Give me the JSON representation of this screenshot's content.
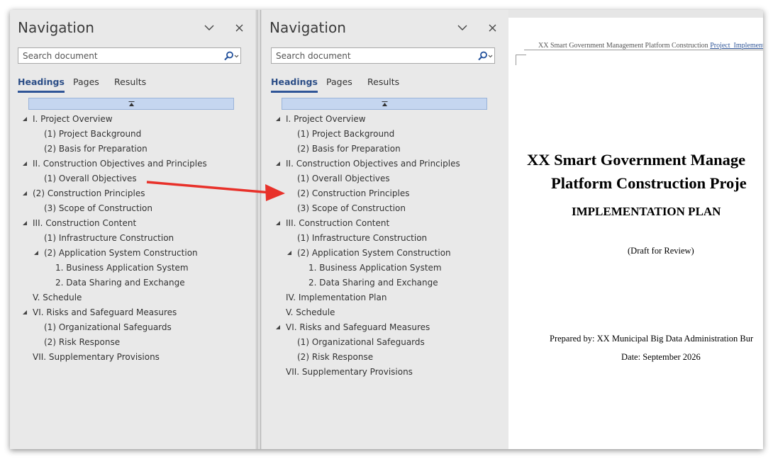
{
  "nav_panes": [
    {
      "title": "Navigation",
      "search_placeholder": "Search document",
      "tabs": [
        "Headings",
        "Pages",
        "Results"
      ],
      "active_tab": "Headings",
      "headings": [
        {
          "text": "I. Project Overview",
          "level": 0,
          "expander": true
        },
        {
          "text": "(1) Project Background",
          "level": 1,
          "expander": false
        },
        {
          "text": "(2) Basis for Preparation",
          "level": 1,
          "expander": false
        },
        {
          "text": "II. Construction Objectives and Principles",
          "level": 0,
          "expander": true
        },
        {
          "text": "(1) Overall Objectives",
          "level": 1,
          "expander": false
        },
        {
          "text": "(2) Construction Principles",
          "level": 0,
          "expander": true
        },
        {
          "text": "(3) Scope of Construction",
          "level": 1,
          "expander": false
        },
        {
          "text": "III. Construction Content",
          "level": 0,
          "expander": true
        },
        {
          "text": "(1) Infrastructure Construction",
          "level": 1,
          "expander": false
        },
        {
          "text": "(2) Application System Construction",
          "level": 1,
          "expander": true
        },
        {
          "text": "1. Business Application System",
          "level": 2,
          "expander": false
        },
        {
          "text": "2. Data Sharing and Exchange",
          "level": 2,
          "expander": false
        },
        {
          "text": "V. Schedule",
          "level": 0,
          "expander": false
        },
        {
          "text": "VI. Risks and Safeguard Measures",
          "level": 0,
          "expander": true
        },
        {
          "text": "(1) Organizational Safeguards",
          "level": 1,
          "expander": false
        },
        {
          "text": "(2) Risk Response",
          "level": 1,
          "expander": false
        },
        {
          "text": "VII. Supplementary Provisions",
          "level": 0,
          "expander": false
        }
      ]
    },
    {
      "title": "Navigation",
      "search_placeholder": "Search document",
      "tabs": [
        "Headings",
        "Pages",
        "Results"
      ],
      "active_tab": "Headings",
      "headings": [
        {
          "text": "I. Project Overview",
          "level": 0,
          "expander": true
        },
        {
          "text": "(1) Project Background",
          "level": 1,
          "expander": false
        },
        {
          "text": "(2) Basis for Preparation",
          "level": 1,
          "expander": false
        },
        {
          "text": "II. Construction Objectives and Principles",
          "level": 0,
          "expander": true
        },
        {
          "text": "(1) Overall Objectives",
          "level": 1,
          "expander": false
        },
        {
          "text": "(2) Construction Principles",
          "level": 1,
          "expander": false
        },
        {
          "text": "(3) Scope of Construction",
          "level": 1,
          "expander": false
        },
        {
          "text": "III. Construction Content",
          "level": 0,
          "expander": true
        },
        {
          "text": "(1) Infrastructure Construction",
          "level": 1,
          "expander": false
        },
        {
          "text": "(2) Application System Construction",
          "level": 1,
          "expander": true
        },
        {
          "text": "1. Business Application System",
          "level": 2,
          "expander": false
        },
        {
          "text": "2. Data Sharing and Exchange",
          "level": 2,
          "expander": false
        },
        {
          "text": "IV. Implementation Plan",
          "level": 0,
          "expander": false
        },
        {
          "text": "V. Schedule",
          "level": 0,
          "expander": false
        },
        {
          "text": "VI. Risks and Safeguard Measures",
          "level": 0,
          "expander": true
        },
        {
          "text": "(1) Organizational Safeguards",
          "level": 1,
          "expander": false
        },
        {
          "text": "(2) Risk Response",
          "level": 1,
          "expander": false
        },
        {
          "text": "VII. Supplementary Provisions",
          "level": 0,
          "expander": false
        }
      ]
    }
  ],
  "document": {
    "header_text": "XX Smart Government Management Platform Construction ",
    "header_link": "Project_Implementa",
    "title_line1": "XX Smart Government Manage",
    "title_line2": "Platform Construction Proje",
    "title_line3": "IMPLEMENTATION PLAN",
    "draft_note": "(Draft for Review)",
    "prepared_by": "Prepared by: XX Municipal Big Data Administration Bur",
    "date": "Date: September 2026"
  },
  "colors": {
    "accent": "#2f5597",
    "arrow": "#e8312a",
    "pane_bg": "#e9e9e9",
    "collapse_bar": "#c5d6f0"
  },
  "icons": [
    "chevron-down-icon",
    "close-icon",
    "search-icon",
    "collapse-all-icon",
    "expanded-triangle-icon"
  ]
}
